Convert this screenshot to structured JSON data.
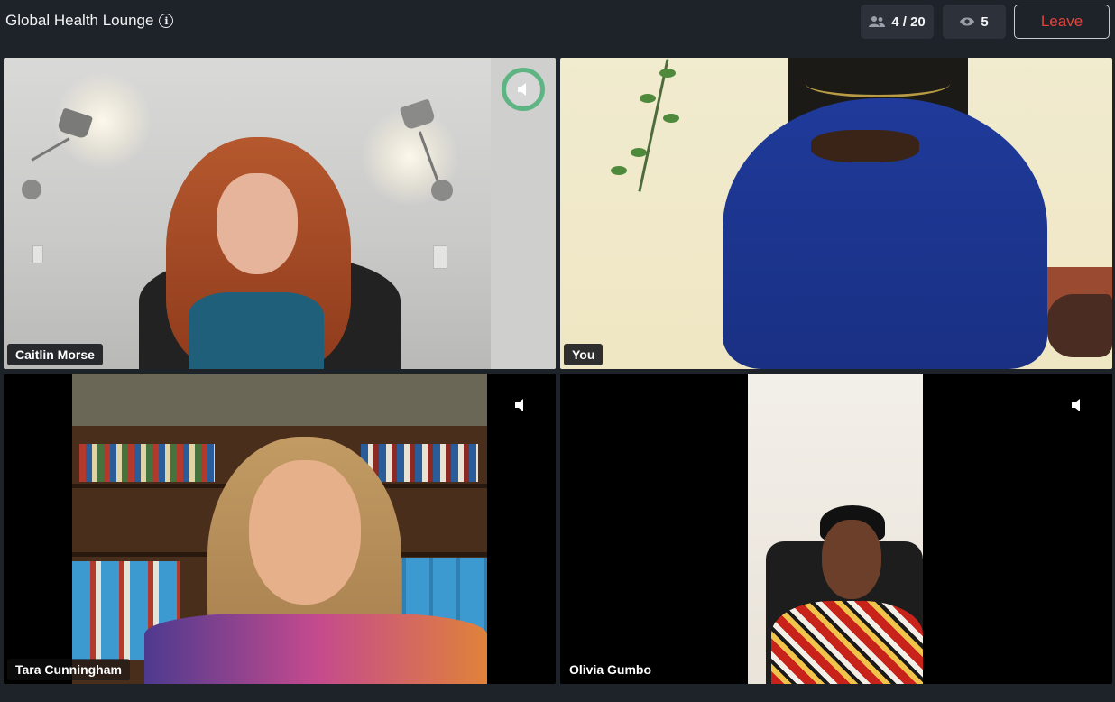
{
  "header": {
    "room_title": "Global Health Lounge",
    "info_icon": "info-icon",
    "participants_label": "4 / 20",
    "participants_icon": "people-icon",
    "viewers_label": "5",
    "viewers_icon": "eye-icon",
    "leave_label": "Leave"
  },
  "colors": {
    "background": "#1e2229",
    "pill": "#2c313a",
    "leave_text": "#e0453e",
    "active_speaker_ring": "#5fb483"
  },
  "tiles": [
    {
      "name": "Caitlin Morse",
      "speaker_icon": "speaker-icon",
      "active_speaker": true
    },
    {
      "name": "You"
    },
    {
      "name": "Tara Cunningham",
      "speaker_icon": "speaker-icon"
    },
    {
      "name": "Olivia Gumbo",
      "speaker_icon": "speaker-icon"
    }
  ]
}
